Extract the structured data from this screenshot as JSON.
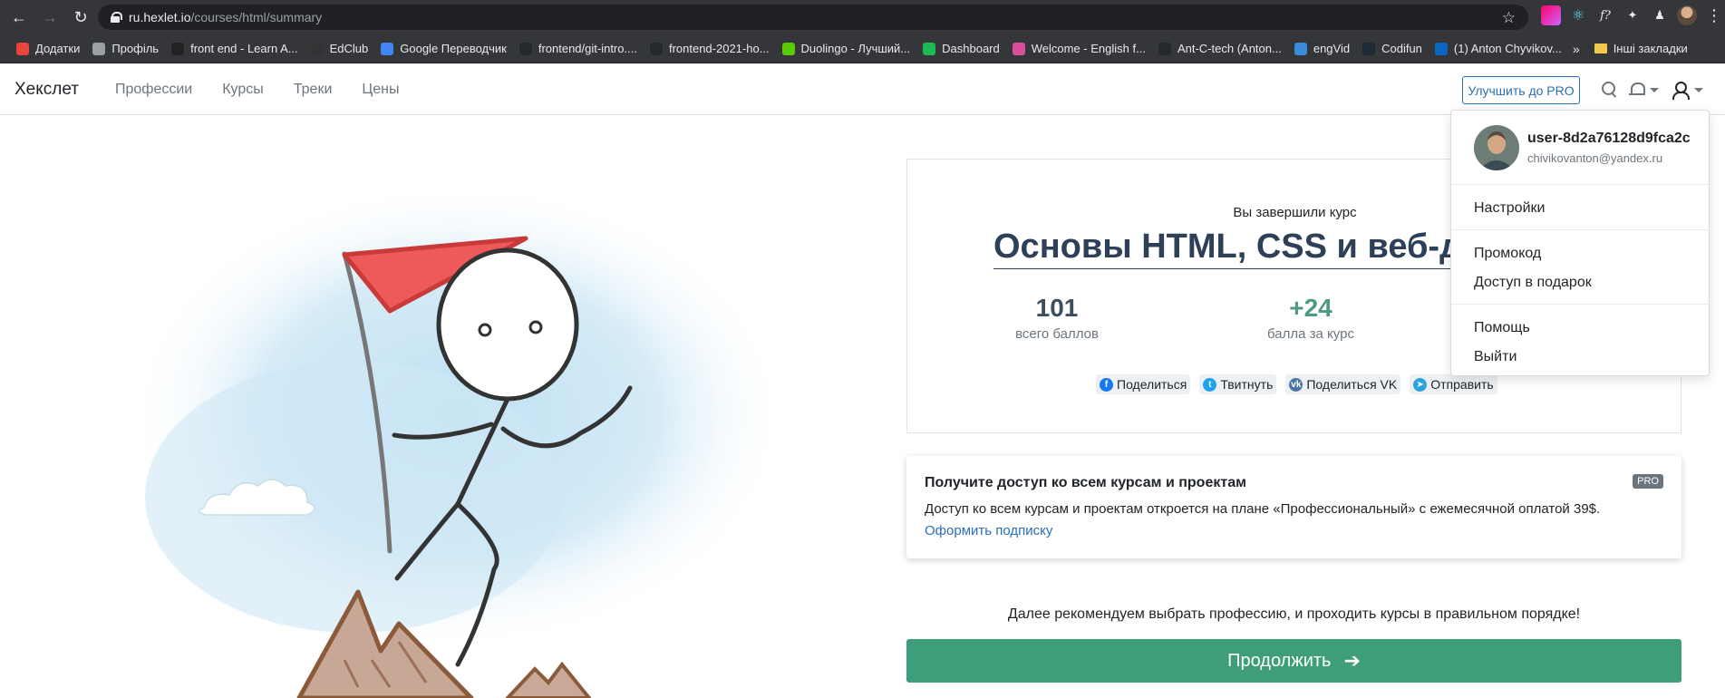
{
  "browser": {
    "url_host": "ru.hexlet.io",
    "url_path": "/courses/html/summary",
    "bookmarks": [
      {
        "label": "Додатки",
        "color": "#e8453c"
      },
      {
        "label": "Профіль",
        "color": "#9aa0a6"
      },
      {
        "label": "front end - Learn A...",
        "color": "#222222"
      },
      {
        "label": "EdClub",
        "color": "#333333"
      },
      {
        "label": "Google Переводчик",
        "color": "#4285f4"
      },
      {
        "label": "frontend/git-intro....",
        "color": "#24292e"
      },
      {
        "label": "frontend-2021-ho...",
        "color": "#24292e"
      },
      {
        "label": "Duolingo - Лучший...",
        "color": "#58cc02"
      },
      {
        "label": "Dashboard",
        "color": "#1db954"
      },
      {
        "label": "Welcome - English f...",
        "color": "#d94f9a"
      },
      {
        "label": "Ant-C-tech (Anton...",
        "color": "#24292e"
      },
      {
        "label": "engVid",
        "color": "#3a8bd9"
      },
      {
        "label": "Codifun",
        "color": "#1e2a38"
      },
      {
        "label": "(1) Anton Chyvikov...",
        "color": "#0a66c2"
      }
    ],
    "bookmarks_more": "»",
    "other_bookmarks": "Інші закладки"
  },
  "header": {
    "brand": "Хекслет",
    "nav": [
      "Профессии",
      "Курсы",
      "Треки",
      "Цены"
    ],
    "pro_button": "Улучшить до PRO"
  },
  "summary": {
    "completed_label": "Вы завершили курс",
    "course_title": "Основы HTML, CSS и веб-дизайна",
    "stats": [
      {
        "value": "101",
        "label": "всего баллов"
      },
      {
        "value": "+24",
        "label": "балла за курс"
      }
    ],
    "share": [
      {
        "label": "Поделиться",
        "icon": "facebook-icon",
        "color": "#1877f2",
        "glyph": "f"
      },
      {
        "label": "Твитнуть",
        "icon": "twitter-icon",
        "color": "#1da1f2",
        "glyph": "t"
      },
      {
        "label": "Поделиться VK",
        "icon": "vk-icon",
        "color": "#4c75a3",
        "glyph": "vk"
      },
      {
        "label": "Отправить",
        "icon": "telegram-icon",
        "color": "#2aa3df",
        "glyph": "➤"
      }
    ]
  },
  "pro_card": {
    "title": "Получите доступ ко всем курсам и проектам",
    "badge": "PRO",
    "text": "Доступ ко всем курсам и проектам откроется на плане «Профессиональный» с ежемесячной оплатой 39$.",
    "link": "Оформить подписку"
  },
  "recommend_text": "Далее рекомендуем выбрать профессию, и проходить курсы в правильном порядке!",
  "continue_button": "Продолжить",
  "user_menu": {
    "username": "user-8d2a76128d9fca2c",
    "email": "chivikovanton@yandex.ru",
    "items": [
      "Настройки",
      "Промокод",
      "Доступ в подарок",
      "Помощь",
      "Выйти"
    ]
  },
  "colors": {
    "primary": "#2c6fb7",
    "success": "#3f9e7a",
    "title": "#2e4057"
  }
}
